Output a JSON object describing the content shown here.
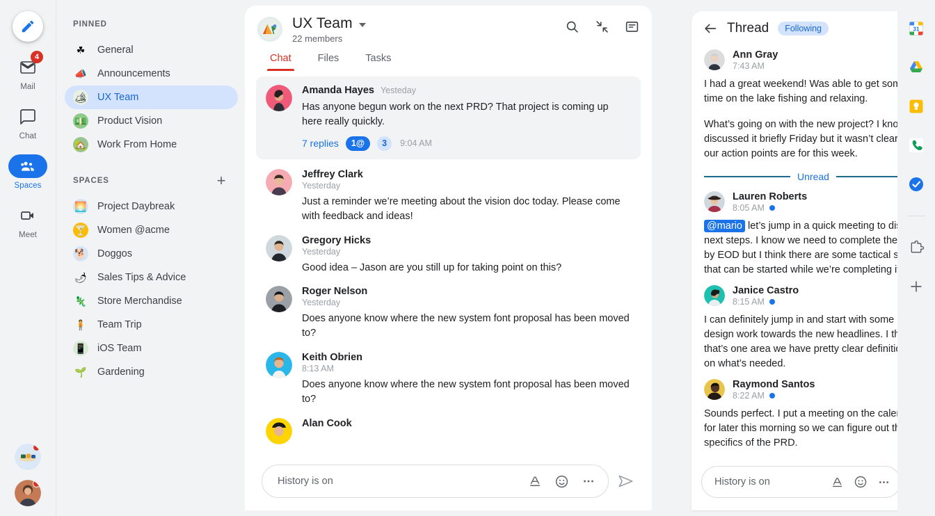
{
  "left_rail": {
    "compose": {
      "label": "Compose",
      "icon": "pencil-icon"
    },
    "items": [
      {
        "label": "Mail",
        "icon": "mail-icon",
        "badge": "4",
        "active": false
      },
      {
        "label": "Chat",
        "icon": "chat-bubble-icon",
        "badge": "",
        "active": false
      },
      {
        "label": "Spaces",
        "icon": "people-group-icon",
        "badge": "",
        "active": true
      },
      {
        "label": "Meet",
        "icon": "video-camera-icon",
        "badge": "",
        "active": false
      }
    ],
    "bottom_avatars": [
      {
        "name": "avatar-sushi",
        "has_dot": true
      },
      {
        "name": "avatar-person",
        "has_dot": true
      }
    ]
  },
  "sidebar": {
    "pinned": {
      "title": "PINNED",
      "items": [
        {
          "label": "General",
          "emoji": "☘️",
          "bg": "#f1f3f4",
          "selected": false
        },
        {
          "label": "Announcements",
          "emoji": "📣",
          "bg": "#f1f3f4",
          "selected": false
        },
        {
          "label": "UX Team",
          "emoji": "🏕️",
          "bg": "#e8f0e4",
          "selected": true
        },
        {
          "label": "Product Vision",
          "emoji": "💵",
          "bg": "#a8d5a2",
          "selected": false
        },
        {
          "label": "Work From Home",
          "emoji": "🏡",
          "bg": "#b6d7a8",
          "selected": false
        }
      ]
    },
    "spaces": {
      "title": "SPACES",
      "add_label": "+",
      "items": [
        {
          "label": "Project Daybreak",
          "emoji": "🌅",
          "bg": "#d6e4f7",
          "selected": false
        },
        {
          "label": "Women @acme",
          "emoji": "🍸",
          "bg": "#fbbc04",
          "selected": false
        },
        {
          "label": "Doggos",
          "emoji": "🐕",
          "bg": "#d6e4f7",
          "selected": false
        },
        {
          "label": "Sales Tips & Advice",
          "emoji": "🌶️",
          "bg": "#f1f3f4",
          "selected": false
        },
        {
          "label": "Store Merchandise",
          "emoji": "🦎",
          "bg": "#f1f3f4",
          "selected": false
        },
        {
          "label": "Team Trip",
          "emoji": "🧍",
          "bg": "#f1f3f4",
          "selected": false
        },
        {
          "label": "iOS Team",
          "emoji": "📱",
          "bg": "#d9ead3",
          "selected": false
        },
        {
          "label": "Gardening",
          "emoji": "🌱",
          "bg": "#f1f3f4",
          "selected": false
        }
      ]
    }
  },
  "main": {
    "space_name": "UX Team",
    "members": "22 members",
    "space_emoji": "🏕️",
    "header_icons": [
      "search-icon",
      "collapse-icon",
      "threads-icon"
    ],
    "tabs": [
      {
        "label": "Chat",
        "active": true
      },
      {
        "label": "Files",
        "active": false
      },
      {
        "label": "Tasks",
        "active": false
      }
    ],
    "highlight_message": {
      "name": "Amanda Hayes",
      "time": "Yesteday",
      "text": "Has anyone begun work on the next PRD? That project is coming up here really quickly.",
      "replies_label": "7 replies",
      "mention_pill": "1@",
      "count_pill": "3",
      "replies_time": "9:04 AM",
      "avatar_bg": "#ef5a78"
    },
    "messages": [
      {
        "name": "Jeffrey Clark",
        "time": "Yesterday",
        "text": "Just a reminder we’re meeting about the vision doc today. Please come with feedback and ideas!",
        "avatar_bg": "#f6aab2"
      },
      {
        "name": "Gregory Hicks",
        "time": "Yesterday",
        "text": "Good idea – Jason are you still up for taking point on this?",
        "avatar_bg": "#cfd8dc"
      },
      {
        "name": "Roger Nelson",
        "time": "Yesterday",
        "text": "Does anyone know where the new system font proposal has been moved to?",
        "avatar_bg": "#9aa0a6"
      },
      {
        "name": "Keith Obrien",
        "time": "8:13 AM",
        "text": "Does anyone know where the new system font proposal has been moved to?",
        "avatar_bg": "#29b6e8"
      },
      {
        "name": "Alan Cook",
        "time": "",
        "text": "",
        "avatar_bg": "#ffd400"
      }
    ],
    "compose": {
      "placeholder": "History is on",
      "icons": [
        "format-text-icon",
        "emoji-icon",
        "more-options-icon"
      ],
      "send_icon": "send-icon"
    }
  },
  "thread": {
    "back_icon": "back-arrow-icon",
    "title": "Thread",
    "following_label": "Following",
    "close_icon": "close-icon",
    "unread_divider_label": "Unread",
    "messages_before_unread": [
      {
        "name": "Ann Gray",
        "time": "7:43 AM",
        "unread": false,
        "avatar_bg": "#d9d9d9",
        "paragraphs": [
          "I had a great weekend! Was able to get some time on the lake fishing and relaxing.",
          "What’s going on with the new project? I know we discussed it briefly Friday but it wasn’t clear what our action points are for this week."
        ]
      }
    ],
    "messages_after_unread": [
      {
        "name": "Lauren Roberts",
        "time": "8:05 AM",
        "unread": true,
        "avatar_bg": "#c79a6e",
        "mention": "@mario",
        "paragraphs": [
          " let’s jump in a quick meeting to discuss next steps. I know we need to complete the PRD by EOD but I think there are some tactical steps that can be started while we’re completing it."
        ]
      },
      {
        "name": "Janice Castro",
        "time": "8:15 AM",
        "unread": true,
        "avatar_bg": "#1fc0b0",
        "mention": "",
        "paragraphs": [
          "I can definitely jump in and start with some design work towards the new headlines. I think that’s one area we have pretty clear definitions on what’s needed."
        ]
      },
      {
        "name": "Raymond Santos",
        "time": "8:22 AM",
        "unread": true,
        "avatar_bg": "#e8c44a",
        "mention": "",
        "paragraphs": [
          "Sounds perfect. I put a meeting on the calendar for later this morning so we can figure out the specifics of the PRD."
        ]
      }
    ],
    "compose": {
      "placeholder": "History is on",
      "icons": [
        "format-text-icon",
        "emoji-icon",
        "more-options-icon"
      ],
      "send_icon": "send-icon"
    }
  },
  "right_rail": {
    "items": [
      {
        "name": "calendar-icon",
        "label": "Calendar"
      },
      {
        "name": "drive-icon",
        "label": "Drive"
      },
      {
        "name": "keep-icon",
        "label": "Keep"
      },
      {
        "name": "voice-icon",
        "label": "Voice"
      },
      {
        "name": "tasks-icon",
        "label": "Tasks"
      },
      {
        "name": "addon-puzzle-icon",
        "label": "Get Add-ons"
      },
      {
        "name": "add-icon",
        "label": "Add"
      }
    ]
  },
  "colors": {
    "accent_blue": "#1a73e8",
    "accent_red": "#d93025",
    "chip_blue_bg": "#d3e3fd",
    "panel_bg": "#f1f3f4"
  }
}
